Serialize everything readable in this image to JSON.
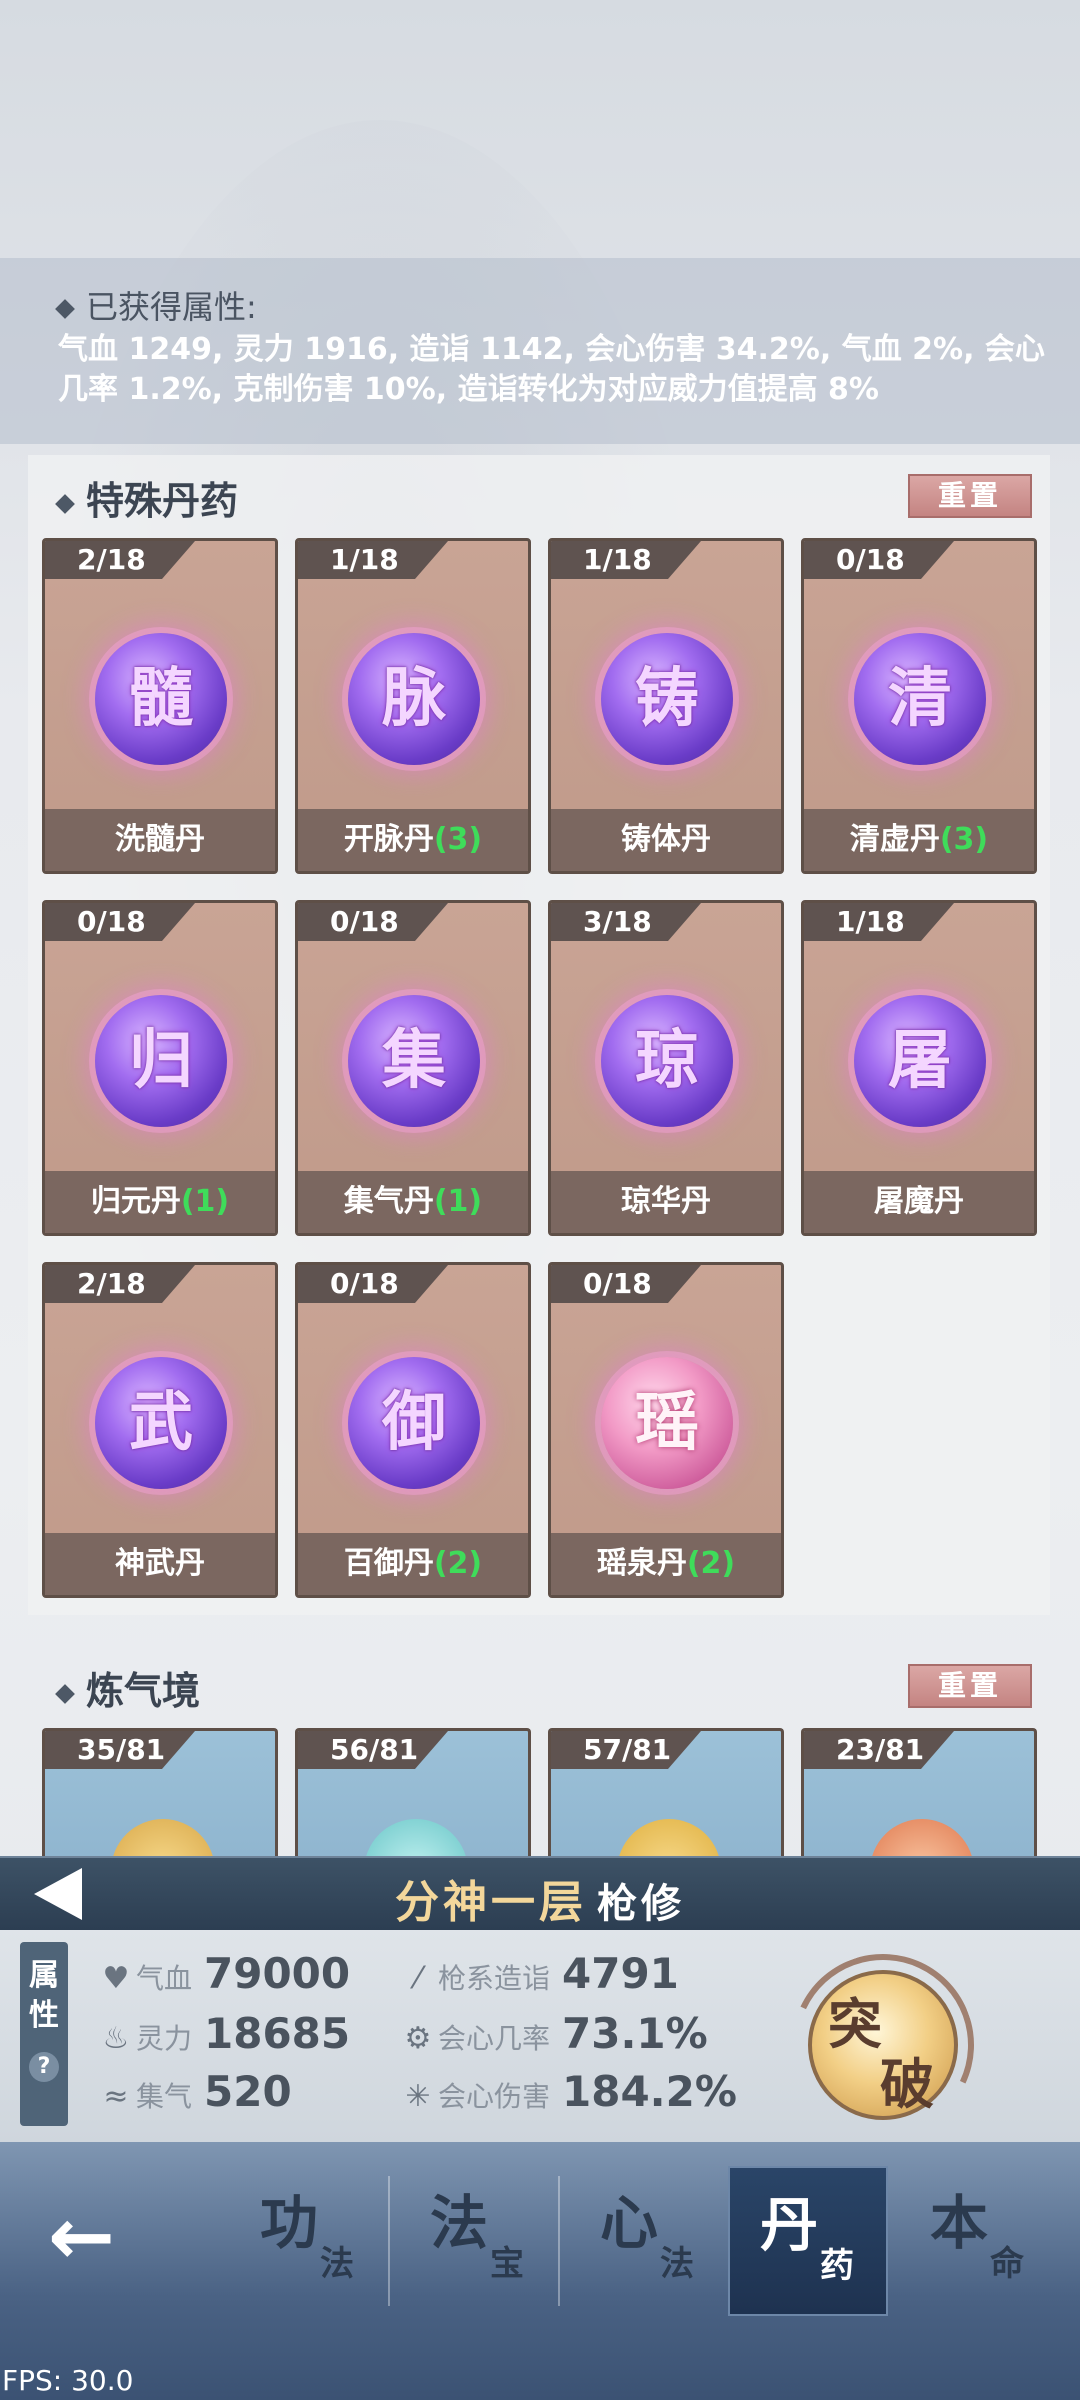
{
  "attributes": {
    "title": "已获得属性:",
    "text": "气血 1249, 灵力 1916, 造诣 1142, 会心伤害 34.2%, 气血 2%, 会心几率 1.2%, 克制伤害 10%, 造诣转化为对应威力值提高 8%"
  },
  "special": {
    "title": "特殊丹药",
    "reset_label": "重置",
    "cards": [
      {
        "count": "2/18",
        "char": "髓",
        "name": "洗髓丹",
        "extra": ""
      },
      {
        "count": "1/18",
        "char": "脉",
        "name": "开脉丹",
        "extra": "(3)"
      },
      {
        "count": "1/18",
        "char": "铸",
        "name": "铸体丹",
        "extra": ""
      },
      {
        "count": "0/18",
        "char": "清",
        "name": "清虚丹",
        "extra": "(3)"
      },
      {
        "count": "0/18",
        "char": "归",
        "name": "归元丹",
        "extra": "(1)"
      },
      {
        "count": "0/18",
        "char": "集",
        "name": "集气丹",
        "extra": "(1)"
      },
      {
        "count": "3/18",
        "char": "琼",
        "name": "琼华丹",
        "extra": ""
      },
      {
        "count": "1/18",
        "char": "屠",
        "name": "屠魔丹",
        "extra": ""
      },
      {
        "count": "2/18",
        "char": "武",
        "name": "神武丹",
        "extra": ""
      },
      {
        "count": "0/18",
        "char": "御",
        "name": "百御丹",
        "extra": "(2)"
      },
      {
        "count": "0/18",
        "char": "瑶",
        "name": "瑶泉丹",
        "extra": "(2)"
      }
    ]
  },
  "qi_realm": {
    "title": "炼气境",
    "reset_label": "重置",
    "cards": [
      {
        "count": "35/81"
      },
      {
        "count": "56/81"
      },
      {
        "count": "57/81"
      },
      {
        "count": "23/81"
      }
    ]
  },
  "rank": {
    "level": "分神一层",
    "class": "枪修"
  },
  "stats": {
    "tag": "属性",
    "help": "?",
    "hp_label": "气血",
    "hp_value": "79000",
    "mp_label": "灵力",
    "mp_value": "18685",
    "qi_label": "集气",
    "qi_value": "520",
    "skill_label": "枪系造诣",
    "skill_value": "4791",
    "crit_rate_label": "会心几率",
    "crit_rate_value": "73.1%",
    "crit_dmg_label": "会心伤害",
    "crit_dmg_value": "184.2%"
  },
  "breakthrough": {
    "c1": "突",
    "c2": "破"
  },
  "nav": {
    "tabs": [
      {
        "big": "功",
        "small": "法"
      },
      {
        "big": "法",
        "small": "宝"
      },
      {
        "big": "心",
        "small": "法"
      },
      {
        "big": "丹",
        "small": "药"
      },
      {
        "big": "本",
        "small": "命"
      }
    ]
  },
  "fps": "FPS: 30.0"
}
